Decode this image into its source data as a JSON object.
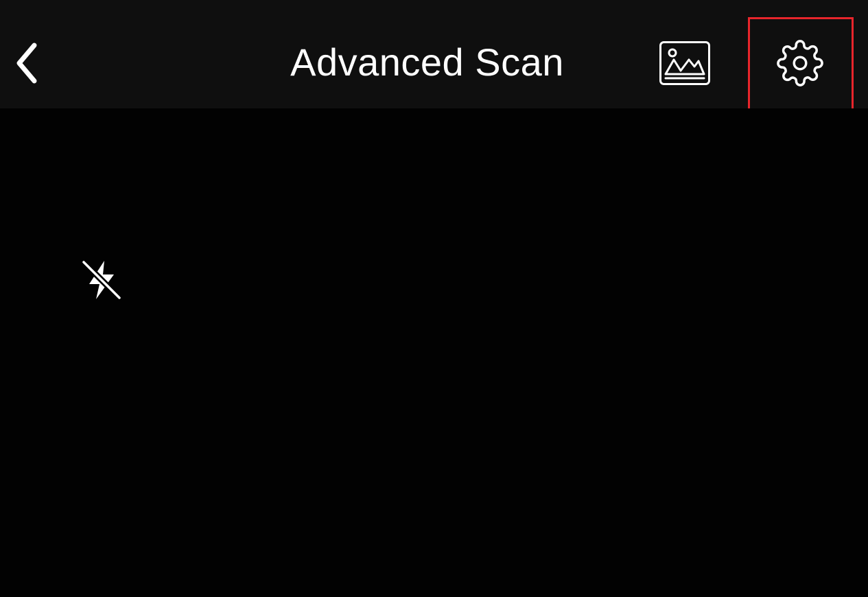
{
  "nav_bar": {
    "title": "Advanced Scan",
    "back_icon": "chevron-left-icon",
    "gallery_icon": "photo-gallery-icon",
    "settings_icon": "gear-icon",
    "background": "#0f0f0f"
  },
  "highlight": {
    "color": "#e8252b",
    "target": "settings-button"
  },
  "camera": {
    "background": "#020202",
    "flash_icon": "flash-off-icon",
    "flash_state": "off"
  },
  "colors": {
    "icon": "#ffffff",
    "text": "#ffffff",
    "screen_background": "#000000"
  }
}
